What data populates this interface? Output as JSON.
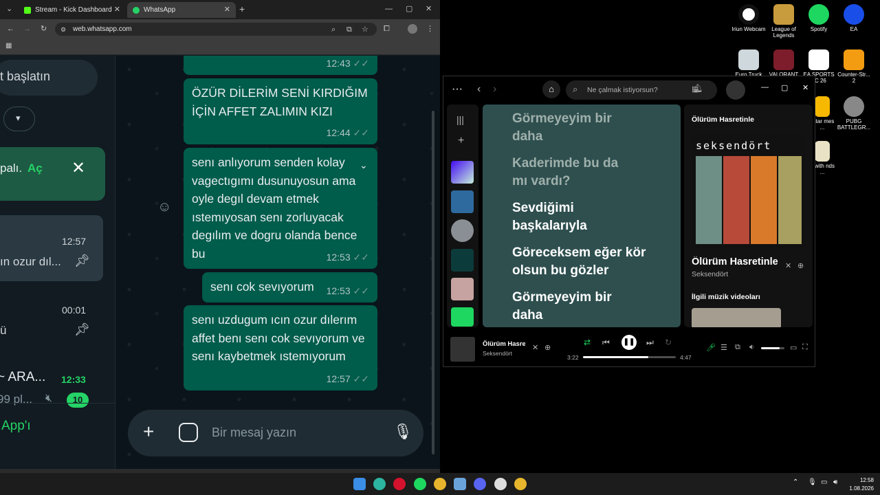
{
  "browser": {
    "tabs": [
      {
        "label": "Stream - Kick Dashboard"
      },
      {
        "label": "WhatsApp"
      }
    ],
    "url": "web.whatsapp.com"
  },
  "wa_left": {
    "search_partial": "t başlatın",
    "banner_text": "palı.",
    "banner_link": "Aç",
    "chats": [
      {
        "time": "12:57",
        "preview": "ın ozur dıl..."
      },
      {
        "time": "00:01",
        "preview": "ü"
      },
      {
        "name": "~ ARA...",
        "time": "12:33",
        "preview": "99 pl...",
        "unread": "10"
      }
    ],
    "footer_link": "App'ı"
  },
  "messages": [
    {
      "text": "",
      "time": "12:43"
    },
    {
      "text": "ÖZÜR DİLERİM SENİ KIRDIĞIM İÇİN AFFET ZALIMIN KIZI",
      "time": "12:44"
    },
    {
      "text": "senı anlıyorum senden kolay vagectıgımı dusunuyosun ama oyle degıl devam etmek ıstemıyosan senı zorluyacak degılım ve dogru olanda bence bu",
      "time": "12:53"
    },
    {
      "text": "senı cok sevıyorum",
      "time": "12:53"
    },
    {
      "text": "senı uzdugum ıcın ozur dılerım affet benı senı cok sevıyorum ve senı kaybetmek ıstemıyorum",
      "time": "12:57"
    }
  ],
  "composer": {
    "placeholder": "Bir mesaj yazın"
  },
  "spotify": {
    "search_placeholder": "Ne çalmak istiyorsun?",
    "lyrics": [
      {
        "text": "Görmeyeyim bir daha",
        "state": "past"
      },
      {
        "text": "Kaderimde bu da mı vardı?",
        "state": "past"
      },
      {
        "text": "Sevdiğimi başkalarıyla",
        "state": "current"
      },
      {
        "text": "Göreceksem eğer kör olsun bu gözler",
        "state": "future"
      },
      {
        "text": "Görmeyeyim bir daha",
        "state": "future"
      }
    ],
    "panel_title": "Ölürüm Hasretinle",
    "album_art_text": "seksendört",
    "track_title": "Ölürüm Hasretinle",
    "artist": "Seksendört",
    "related_label": "İlgili müzik videoları",
    "now_playing_title": "Ölürüm Hasre",
    "now_playing_artist": "Seksendört",
    "elapsed": "3:22",
    "duration": "4:47",
    "progress": 0.7,
    "volume": 0.8
  },
  "desktop_icons": [
    {
      "label": "Iriun Webcam"
    },
    {
      "label": "League of Legends"
    },
    {
      "label": "Spotify"
    },
    {
      "label": "EA"
    },
    {
      "label": "Euro Truck"
    },
    {
      "label": "VALORANT"
    },
    {
      "label": "EA SPORTS FC 26"
    },
    {
      "label": "Counter-Str... 2"
    },
    {
      "label": "kstar mes ..."
    },
    {
      "label": "PUBG BATTLEGR..."
    },
    {
      "label": "e with nds ..."
    }
  ],
  "taskbar": {
    "time": "12:58",
    "date": "1.08.2026"
  },
  "colors": {
    "wa_green": "#005c4b",
    "wa_accent": "#25d366",
    "spotify_green": "#1ed760",
    "lyrics_bg": "#2f4f4f"
  }
}
